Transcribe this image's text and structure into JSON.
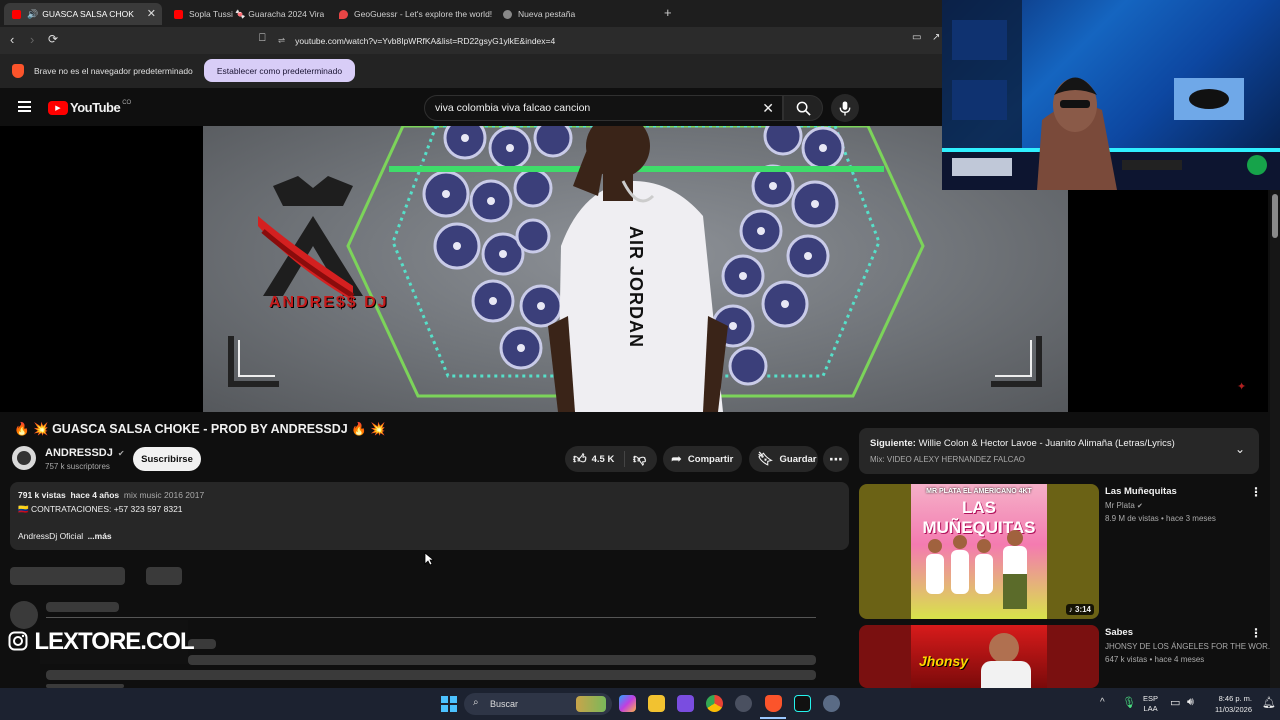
{
  "browser": {
    "tabs": [
      {
        "label": "GUASCA SALSA CHOK",
        "active": true
      },
      {
        "label": "Sopla Tussi 🍬 Guaracha 2024 Viral",
        "active": false
      },
      {
        "label": "GeoGuessr - Let's explore the world!",
        "active": false
      },
      {
        "label": "Nueva pestaña",
        "active": false
      }
    ],
    "new_tab": "+",
    "url": "youtube.com/watch?v=Yvb8IpWRfKA&list=RD22gsyG1ylkE&index=4",
    "infobar_text": "Brave no es el navegador predeterminado",
    "infobar_button": "Establecer como predeterminado"
  },
  "youtube": {
    "logo_text": "YouTube",
    "region": "CO",
    "search_value": "viva colombia viva falcao cancion"
  },
  "video": {
    "title": "🔥 💥 GUASCA SALSA CHOKE - PROD BY ANDRESSDJ 🔥 💥",
    "channel": "ANDRESSDJ",
    "subscribers": "757 k suscriptores",
    "subscribe_label": "Suscribirse",
    "likes": "4.5 K",
    "share_label": "Compartir",
    "save_label": "Guardar",
    "views": "791 k vistas",
    "age": "hace 4 años",
    "tags": "mix music 2016 2017",
    "contact": "🇨🇴 CONTRATACIONES: +57 323 597 8321",
    "desc_line": "AndressDj Oficial",
    "more_label": "...más",
    "shirt_text": "AIR JORDAN",
    "logo_text": "ANDRE$$ DJ"
  },
  "playlist": {
    "next_prefix": "Siguiente:",
    "next_title": "Willie Colon & Hector Lavoe - Juanito Alimaña (Letras/Lyrics)",
    "mix_label": "Mix: VIDEO ALEXY HERNANDEZ FALCAO"
  },
  "recommendations": [
    {
      "title": "Las Muñequitas",
      "channel": "Mr Plata",
      "meta": "8.9 M de vistas • hace 3 meses",
      "duration": "♪ 3:14",
      "thumb_text_1": "MR PLATA EL AMERICANO 4KT",
      "thumb_text_2": "LAS MUÑEQUITAS"
    },
    {
      "title": "Sabes",
      "channel": "JHONSY DE LOS ÁNGELES FOR THE WOR...",
      "meta": "647 k vistas • hace 4 meses",
      "duration": "",
      "thumb_text_1": "Jhonsy",
      "thumb_text_2": ""
    }
  ],
  "overlay": {
    "watermark": "LEXTORE.COL"
  },
  "taskbar": {
    "search_label": "Buscar",
    "lang_1": "ESP",
    "lang_2": "LAA",
    "time": "8:46 p. m.",
    "date": "11/03/2026"
  },
  "colors": {
    "accent_red": "#ff0000",
    "background": "#0f0f0f",
    "chip": "#272727",
    "infobar_button": "#d8cdf7"
  }
}
